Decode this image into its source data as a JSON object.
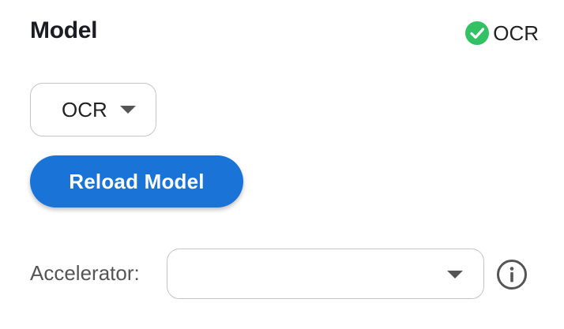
{
  "header": {
    "title": "Model",
    "status_label": "OCR",
    "status_icon": "check-circle-icon",
    "status_color": "#33c263"
  },
  "model_select": {
    "value": "OCR",
    "caret_icon": "chevron-down-icon"
  },
  "reload_button": {
    "label": "Reload Model",
    "color": "#1a73d6"
  },
  "accelerator": {
    "label": "Accelerator:",
    "value": "",
    "caret_icon": "chevron-down-icon",
    "info_icon": "info-icon"
  }
}
